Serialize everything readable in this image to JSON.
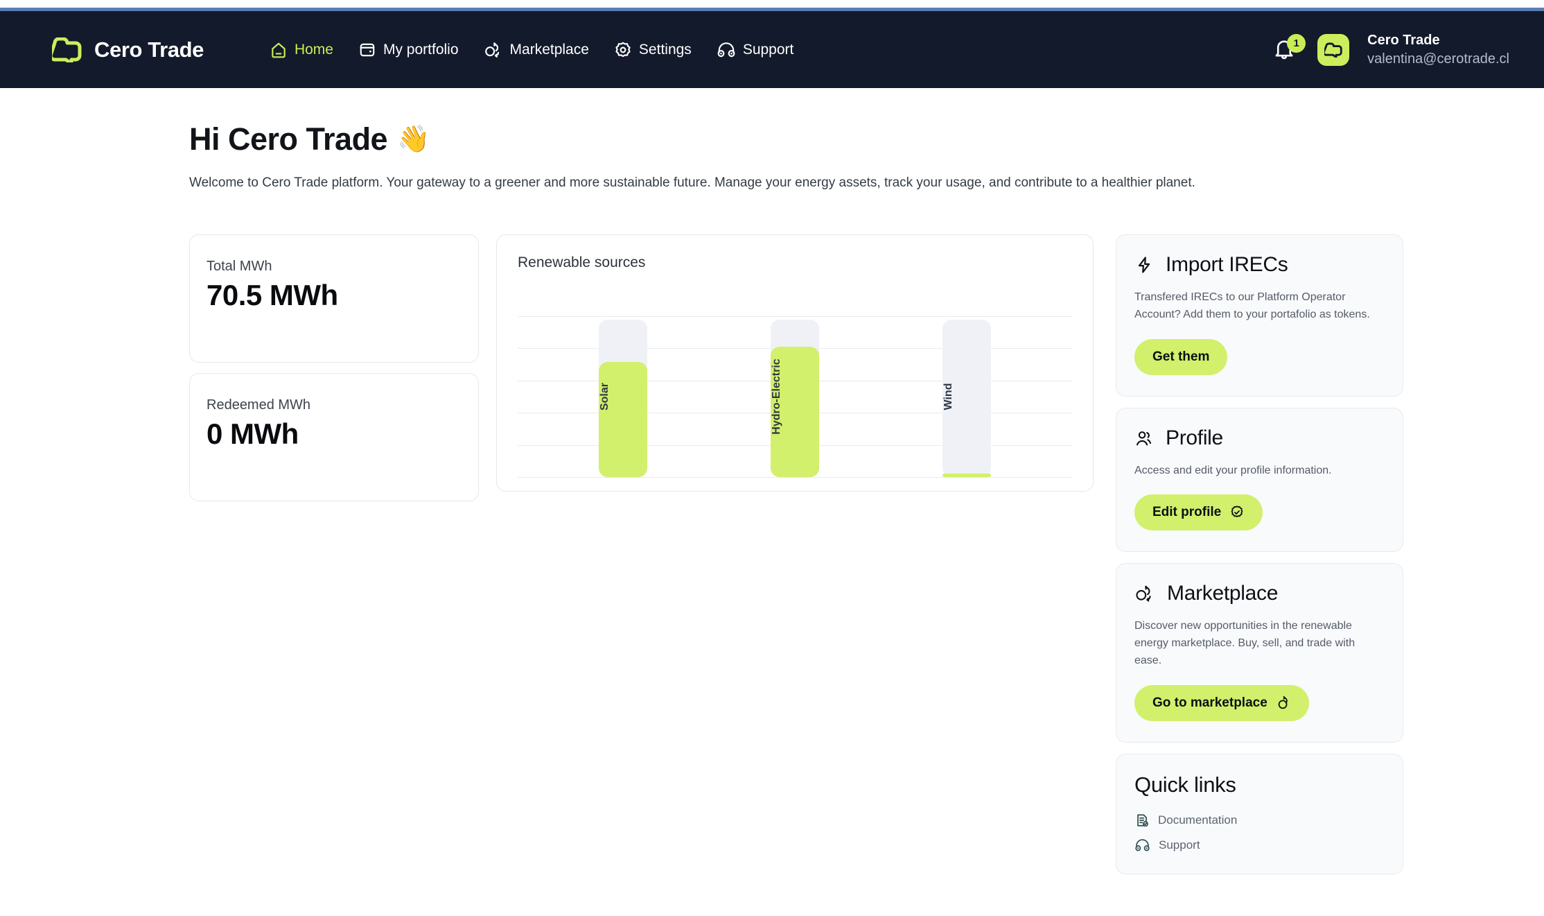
{
  "header": {
    "brand": "Cero Trade",
    "logo_icon": "cero-logo-icon",
    "nav": [
      {
        "label": "Home",
        "icon": "home-icon",
        "active": true
      },
      {
        "label": "My portfolio",
        "icon": "wallet-icon",
        "active": false
      },
      {
        "label": "Marketplace",
        "icon": "marketplace-icon",
        "active": false
      },
      {
        "label": "Settings",
        "icon": "gear-icon",
        "active": false
      },
      {
        "label": "Support",
        "icon": "headset-icon",
        "active": false
      }
    ],
    "notifications": {
      "icon": "bell-icon",
      "count": "1"
    },
    "account": {
      "avatar_icon": "cero-avatar-icon",
      "name": "Cero Trade",
      "email": "valentina@cerotrade.cl"
    }
  },
  "main": {
    "greeting": "Hi Cero Trade",
    "wave_emoji": "👋",
    "subtitle": "Welcome to Cero Trade platform. Your gateway to a greener and more sustainable future. Manage your energy assets, track your usage, and contribute to a healthier planet."
  },
  "stats": [
    {
      "label": "Total MWh",
      "value": "70.5 MWh"
    },
    {
      "label": "Redeemed MWh",
      "value": "0 MWh"
    }
  ],
  "chart_data": {
    "type": "bar",
    "title": "Renewable sources",
    "categories": [
      "Solar",
      "Hydro-Electric",
      "Wind"
    ],
    "values": [
      73,
      83,
      2
    ],
    "series": [
      {
        "name": "Renewable sources",
        "values": [
          73,
          83,
          2
        ]
      }
    ],
    "xlabel": "",
    "ylabel": "",
    "ylim": [
      0,
      100
    ],
    "grid": true,
    "gridline_count": 6,
    "legend": "none",
    "bar_color": "#d2f06b",
    "track_color": "#eff1f6"
  },
  "panel": {
    "cards": [
      {
        "id": "import-irecs",
        "icon": "bolt-icon",
        "title": "Import IRECs",
        "description": "Transfered IRECs to our Platform Operator Account? Add them to your portafolio as tokens.",
        "button": {
          "label": "Get them",
          "icon": "none"
        }
      },
      {
        "id": "profile",
        "icon": "users-icon",
        "title": "Profile",
        "description": "Access and edit your profile information.",
        "button": {
          "label": "Edit profile",
          "icon": "verified-badge-icon"
        }
      },
      {
        "id": "marketplace",
        "icon": "marketplace-icon",
        "title": "Marketplace",
        "description": "Discover new opportunities in the renewable energy marketplace. Buy, sell, and trade with ease.",
        "button": {
          "label": "Go to marketplace",
          "icon": "swap-icon"
        }
      }
    ],
    "quick_links": {
      "title": "Quick links",
      "items": [
        {
          "label": "Documentation",
          "icon": "document-check-icon"
        },
        {
          "label": "Support",
          "icon": "headset-icon"
        }
      ]
    }
  },
  "colors": {
    "accent_lime": "#d2f06b",
    "header_navy": "#131a2c",
    "nav_active": "#c9ee55",
    "top_strip_blue": "#5b7fb4"
  }
}
